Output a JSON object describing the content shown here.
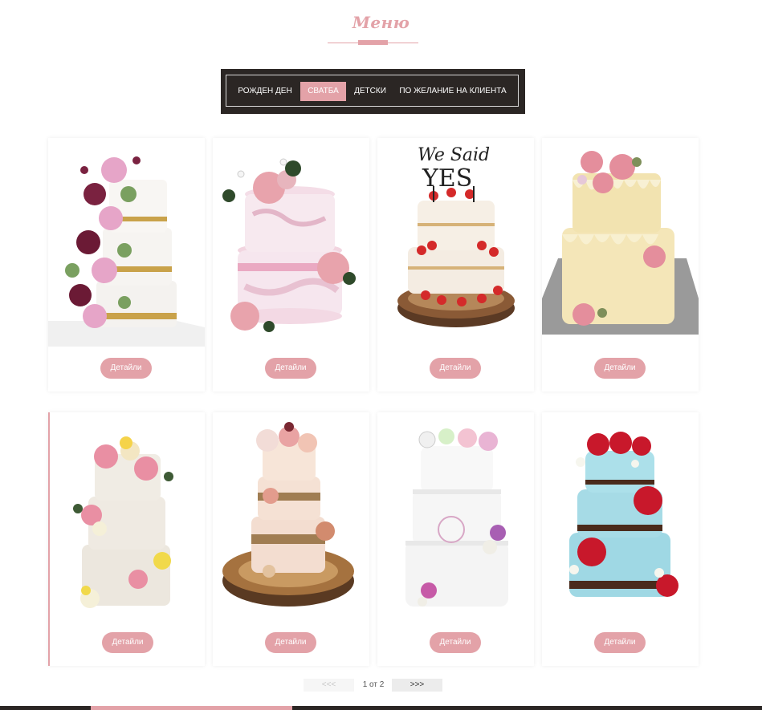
{
  "section": {
    "title": "Меню"
  },
  "filters": {
    "tabs": [
      {
        "label": "РОЖДЕН ДЕН",
        "active": false
      },
      {
        "label": "СВАТБА",
        "active": true
      },
      {
        "label": "ДЕТСКИ",
        "active": false
      },
      {
        "label": "ПО ЖЕЛАНИЕ НА КЛИЕНТА",
        "active": false
      }
    ]
  },
  "cards": [
    {
      "image": "cake-flower-cascade-icon",
      "button": "Детайли"
    },
    {
      "image": "cake-pink-marble-icon",
      "button": "Детайли"
    },
    {
      "image": "cake-we-said-yes-icon",
      "button": "Детайли"
    },
    {
      "image": "cake-cream-drip-icon",
      "button": "Детайли"
    },
    {
      "image": "cake-semi-naked-flowers-icon",
      "button": "Детайли"
    },
    {
      "image": "cake-rustic-wood-icon",
      "button": "Детайли"
    },
    {
      "image": "cake-white-fondant-icon",
      "button": "Детайли"
    },
    {
      "image": "cake-blue-drip-roses-icon",
      "button": "Детайли"
    }
  ],
  "pagination": {
    "prev": "<<<",
    "info": "1 от 2",
    "next": ">>>"
  },
  "colors": {
    "accent": "#e3a2a8",
    "dark": "#2b2624"
  }
}
